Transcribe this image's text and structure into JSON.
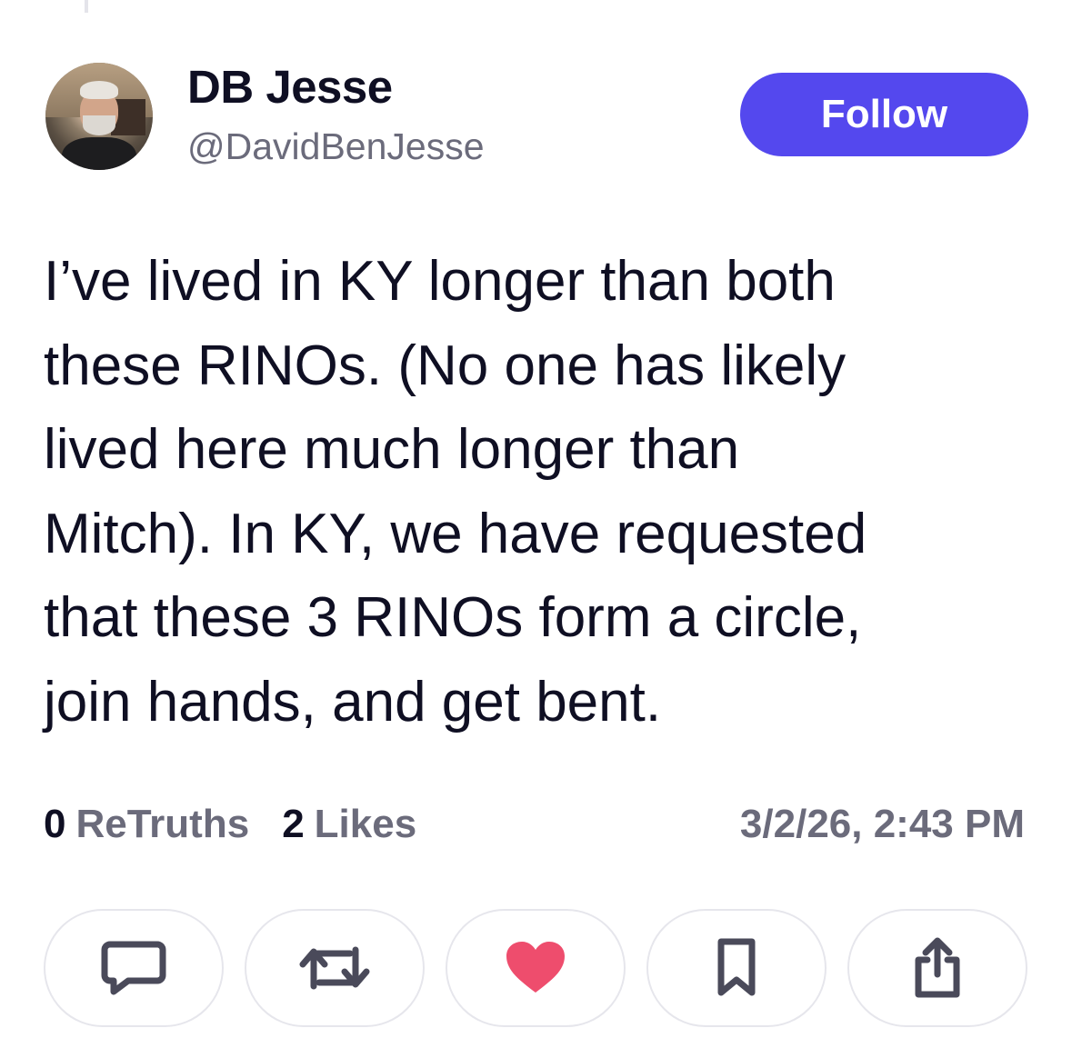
{
  "post": {
    "author": {
      "display_name": "DB Jesse",
      "handle": "@DavidBenJesse"
    },
    "follow_label": "Follow",
    "text": "I’ve lived in KY longer than both\nthese RINOs. (No one has likely\nlived here much longer than\nMitch). In KY, we have requested\nthat these 3 RINOs form a circle,\njoin hands, and get bent.",
    "stats": {
      "retruths_count": "0",
      "retruths_label": "ReTruths",
      "likes_count": "2",
      "likes_label": "Likes"
    },
    "timestamp": "3/2/26, 2:43 PM"
  },
  "actions": [
    {
      "icon": "comment-icon"
    },
    {
      "icon": "retruth-icon"
    },
    {
      "icon": "heart-icon",
      "state": "liked"
    },
    {
      "icon": "bookmark-icon"
    },
    {
      "icon": "share-icon"
    }
  ],
  "colors": {
    "accent": "#5448ee",
    "like": "#ee4d6d",
    "text_primary": "#0f0f23",
    "text_secondary": "#6b6b7b",
    "icon": "#4a4a5a"
  }
}
